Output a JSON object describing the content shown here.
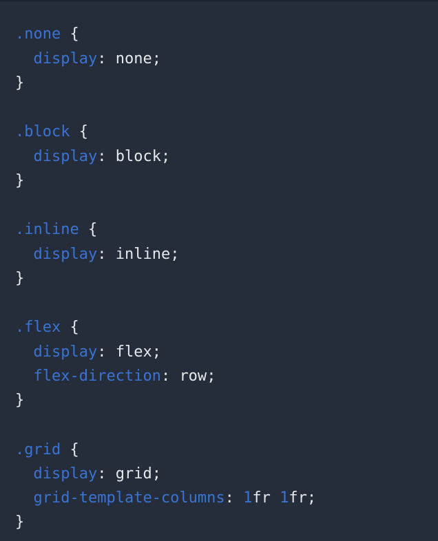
{
  "code": {
    "blocks": [
      {
        "selector": ".none",
        "declarations": [
          {
            "property": "display",
            "value": "none"
          }
        ]
      },
      {
        "selector": ".block",
        "declarations": [
          {
            "property": "display",
            "value": "block"
          }
        ]
      },
      {
        "selector": ".inline",
        "declarations": [
          {
            "property": "display",
            "value": "inline"
          }
        ]
      },
      {
        "selector": ".flex",
        "declarations": [
          {
            "property": "display",
            "value": "flex"
          },
          {
            "property": "flex-direction",
            "value": "row"
          }
        ]
      },
      {
        "selector": ".grid",
        "declarations": [
          {
            "property": "display",
            "value": "grid"
          },
          {
            "property": "grid-template-columns",
            "value_parts": [
              "1",
              "fr ",
              "1",
              "fr"
            ]
          }
        ]
      }
    ],
    "tokens": {
      "open_brace": " {",
      "close_brace": "}",
      "colon": ": ",
      "semicolon": ";"
    }
  },
  "colors": {
    "background": "#252d3b",
    "keyword_blue": "#3b73d4",
    "text": "#e6e8ec"
  }
}
